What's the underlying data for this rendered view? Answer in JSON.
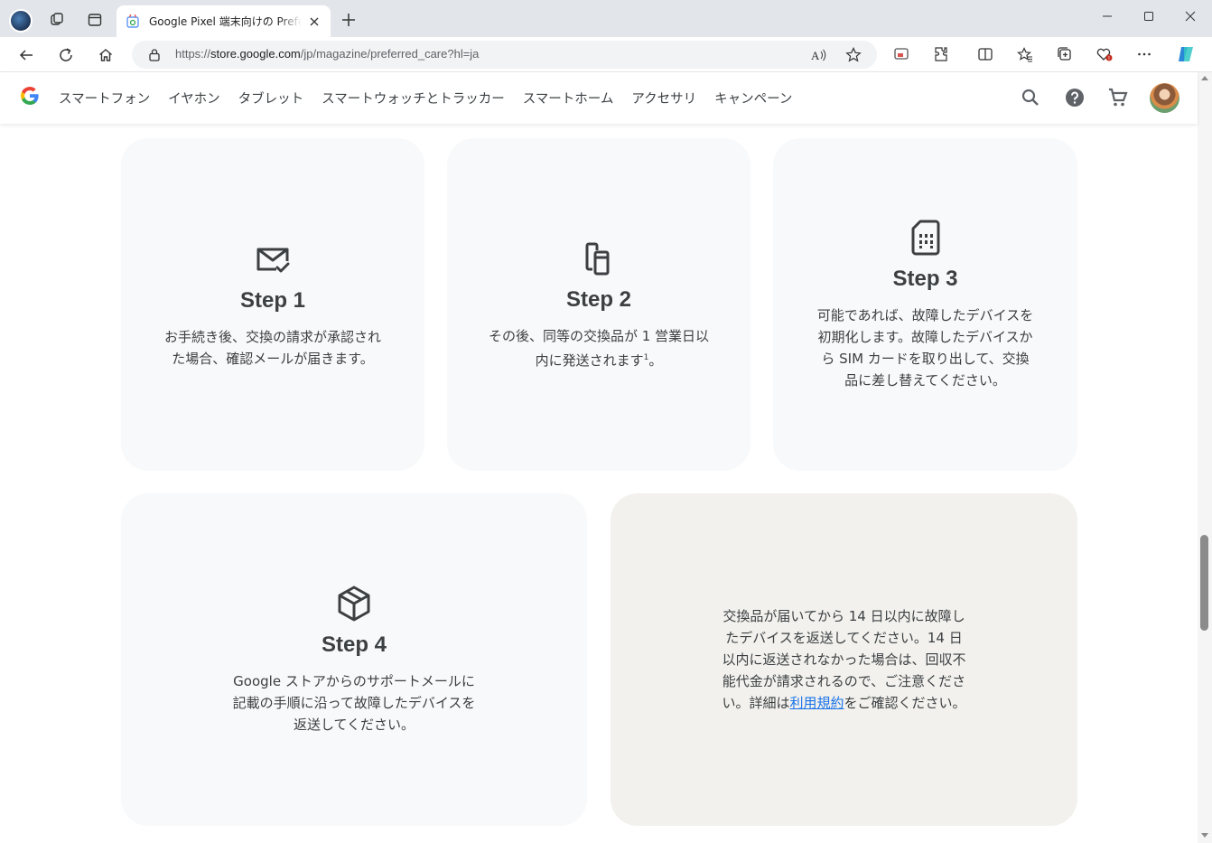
{
  "browser": {
    "tab_title": "Google Pixel 端末向けの Preferred Care",
    "url_prefix": "https://",
    "url_host": "store.google.com",
    "url_path": "/jp/magazine/preferred_care?hl=ja"
  },
  "header": {
    "nav": [
      "スマートフォン",
      "イヤホン",
      "タブレット",
      "スマートウォッチとトラッカー",
      "スマートホーム",
      "アクセサリ",
      "キャンペーン"
    ],
    "icons": [
      "search-icon",
      "help-icon",
      "cart-icon"
    ]
  },
  "steps": [
    {
      "title": "Step 1",
      "lines": [
        "お手続き後、交換の請求が承認され",
        "た場合、確認メールが届きます。"
      ],
      "icon": "mail-check-icon"
    },
    {
      "title": "Step 2",
      "lines": [
        "その後、同等の交換品が 1 営業日以",
        "内に発送されます"
      ],
      "footnote": "1",
      "suffix": "。",
      "icon": "devices-icon"
    },
    {
      "title": "Step 3",
      "lines": [
        "可能であれば、故障したデバイスを",
        "初期化します。故障したデバイスか",
        "ら SIM カードを取り出して、交換",
        "品に差し替えてください。"
      ],
      "icon": "sim-card-icon"
    },
    {
      "title": "Step 4",
      "lines": [
        "Google ストアからのサポートメールに",
        "記載の手順に沿って故障したデバイスを",
        "返送してください。"
      ],
      "icon": "package-icon"
    }
  ],
  "note": {
    "lines": [
      "交換品が届いてから 14 日以内に故障し",
      "たデバイスを返送してください。14 日",
      "以内に返送されなかった場合は、回収不",
      "能代金が請求されるので、ご注意くださ"
    ],
    "last_prefix": "い。詳細は",
    "link": "利用規約",
    "last_suffix": "をご確認ください。"
  },
  "colors": {
    "card_bg": "#f8f9fa",
    "note_bg": "#f2f1ed",
    "link": "#1a73e8",
    "text": "#3c4043"
  }
}
